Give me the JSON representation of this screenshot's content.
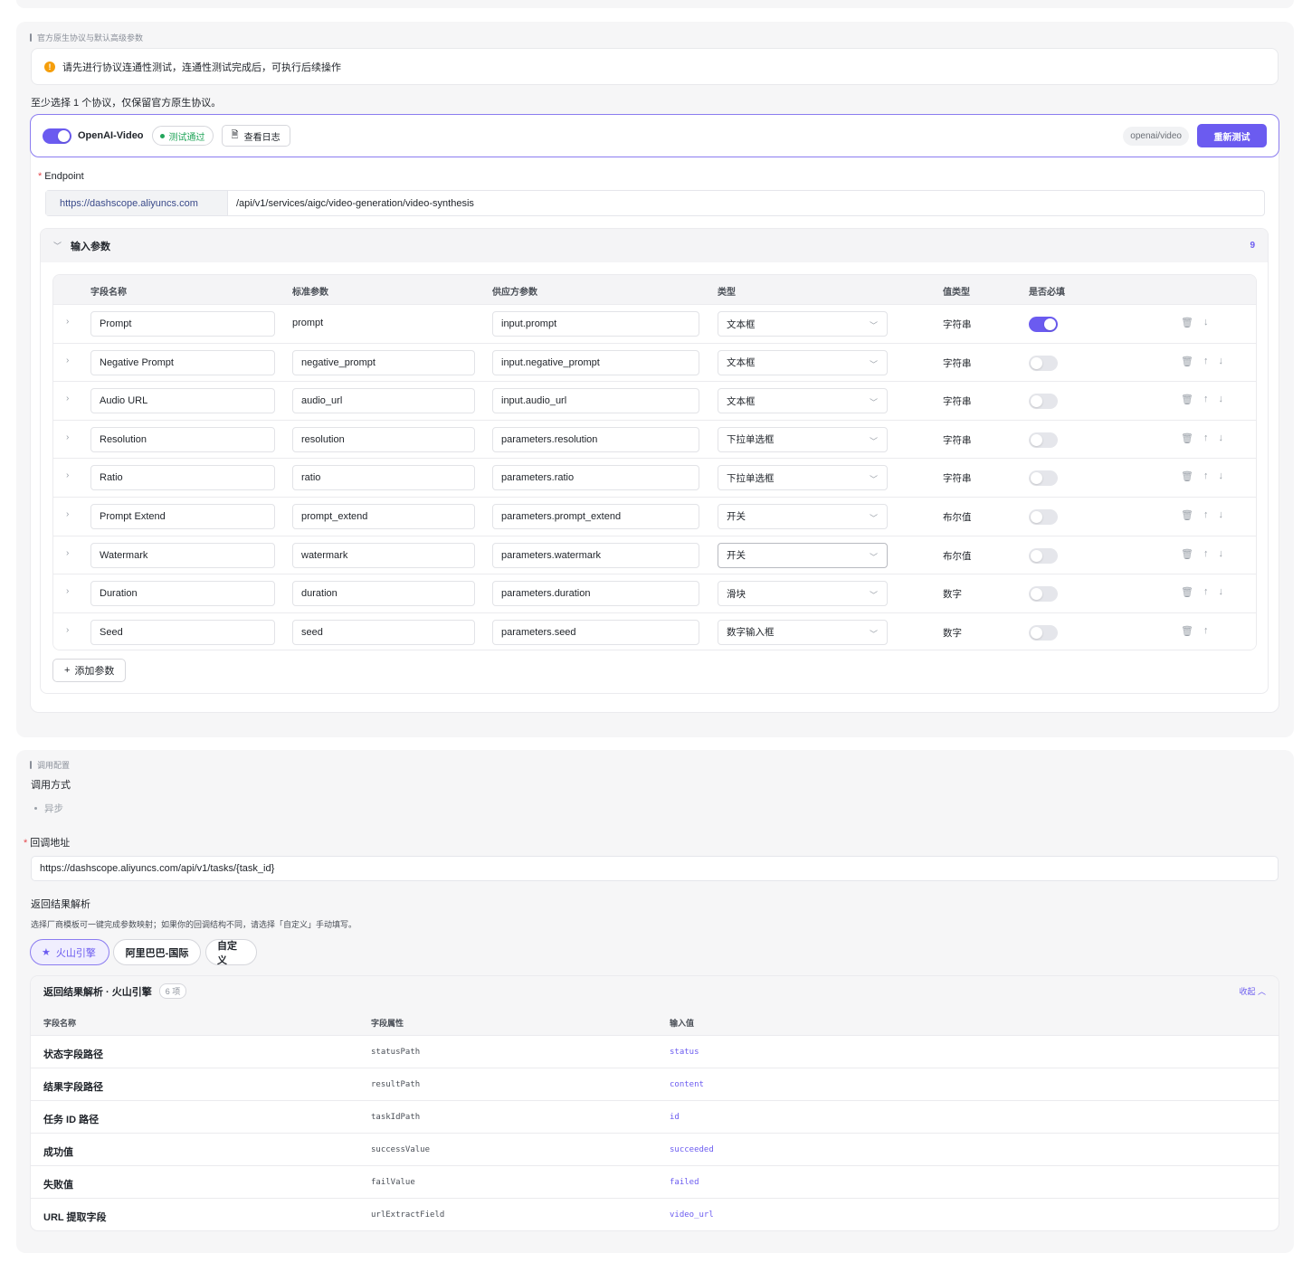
{
  "protocol_section": {
    "title": "官方原生协议与默认高级参数",
    "notice": "请先进行协议连通性测试，连通性测试完成后，可执行后续操作",
    "hint": "至少选择 1 个协议，仅保留官方原生协议。",
    "protocol": {
      "enabled": true,
      "name": "OpenAI-Video",
      "status": "测试通过",
      "log_button": "查看日志",
      "path_chip": "openai/video",
      "retest_button": "重新测试"
    },
    "endpoint": {
      "label": "Endpoint",
      "base": "https://dashscope.aliyuncs.com",
      "path": "/api/v1/services/aigc/video-generation/video-synthesis"
    },
    "params": {
      "title": "输入参数",
      "count": "9",
      "headers": {
        "field": "字段名称",
        "standard": "标准参数",
        "vendor": "供应方参数",
        "type": "类型",
        "value_type": "值类型",
        "required": "是否必填"
      },
      "rows": [
        {
          "field": "Prompt",
          "standard": "prompt",
          "vendor": "input.prompt",
          "type": "文本框",
          "value_type": "字符串",
          "required": true
        },
        {
          "field": "Negative Prompt",
          "standard": "negative_prompt",
          "vendor": "input.negative_prompt",
          "type": "文本框",
          "value_type": "字符串",
          "required": false
        },
        {
          "field": "Audio URL",
          "standard": "audio_url",
          "vendor": "input.audio_url",
          "type": "文本框",
          "value_type": "字符串",
          "required": false
        },
        {
          "field": "Resolution",
          "standard": "resolution",
          "vendor": "parameters.resolution",
          "type": "下拉单选框",
          "value_type": "字符串",
          "required": false
        },
        {
          "field": "Ratio",
          "standard": "ratio",
          "vendor": "parameters.ratio",
          "type": "下拉单选框",
          "value_type": "字符串",
          "required": false
        },
        {
          "field": "Prompt Extend",
          "standard": "prompt_extend",
          "vendor": "parameters.prompt_extend",
          "type": "开关",
          "value_type": "布尔值",
          "required": false
        },
        {
          "field": "Watermark",
          "standard": "watermark",
          "vendor": "parameters.watermark",
          "type": "开关",
          "value_type": "布尔值",
          "required": false
        },
        {
          "field": "Duration",
          "standard": "duration",
          "vendor": "parameters.duration",
          "type": "滑块",
          "value_type": "数字",
          "required": false
        },
        {
          "field": "Seed",
          "standard": "seed",
          "vendor": "parameters.seed",
          "type": "数字输入框",
          "value_type": "数字",
          "required": false
        }
      ],
      "add_button": "添加参数"
    }
  },
  "invoke_section": {
    "title": "调用配置",
    "mode_label": "调用方式",
    "mode_option": "异步",
    "callback_label": "回调地址",
    "callback_url": "https://dashscope.aliyuncs.com/api/v1/tasks/{task_id}",
    "parse_label": "返回结果解析",
    "parse_hint": "选择厂商模板可一键完成参数映射；如果你的回调结构不同，请选择「自定义」手动填写。",
    "vendors": [
      "火山引擎",
      "阿里巴巴-国际",
      "自定义"
    ],
    "result": {
      "title": "返回结果解析 · 火山引擎",
      "count": "6 项",
      "collapse": "收起",
      "headers": {
        "name": "字段名称",
        "attr": "字段属性",
        "value": "输入值"
      },
      "rows": [
        {
          "name": "状态字段路径",
          "attr": "statusPath",
          "value": "status"
        },
        {
          "name": "结果字段路径",
          "attr": "resultPath",
          "value": "content"
        },
        {
          "name": "任务 ID 路径",
          "attr": "taskIdPath",
          "value": "id"
        },
        {
          "name": "成功值",
          "attr": "successValue",
          "value": "succeeded"
        },
        {
          "name": "失败值",
          "attr": "failValue",
          "value": "failed"
        },
        {
          "name": "URL 提取字段",
          "attr": "urlExtractField",
          "value": "video_url"
        }
      ]
    }
  },
  "colors": {
    "accent": "#6b5bf0",
    "success": "#22a55a",
    "warning": "#f59e0b",
    "required": "#e5484d"
  }
}
